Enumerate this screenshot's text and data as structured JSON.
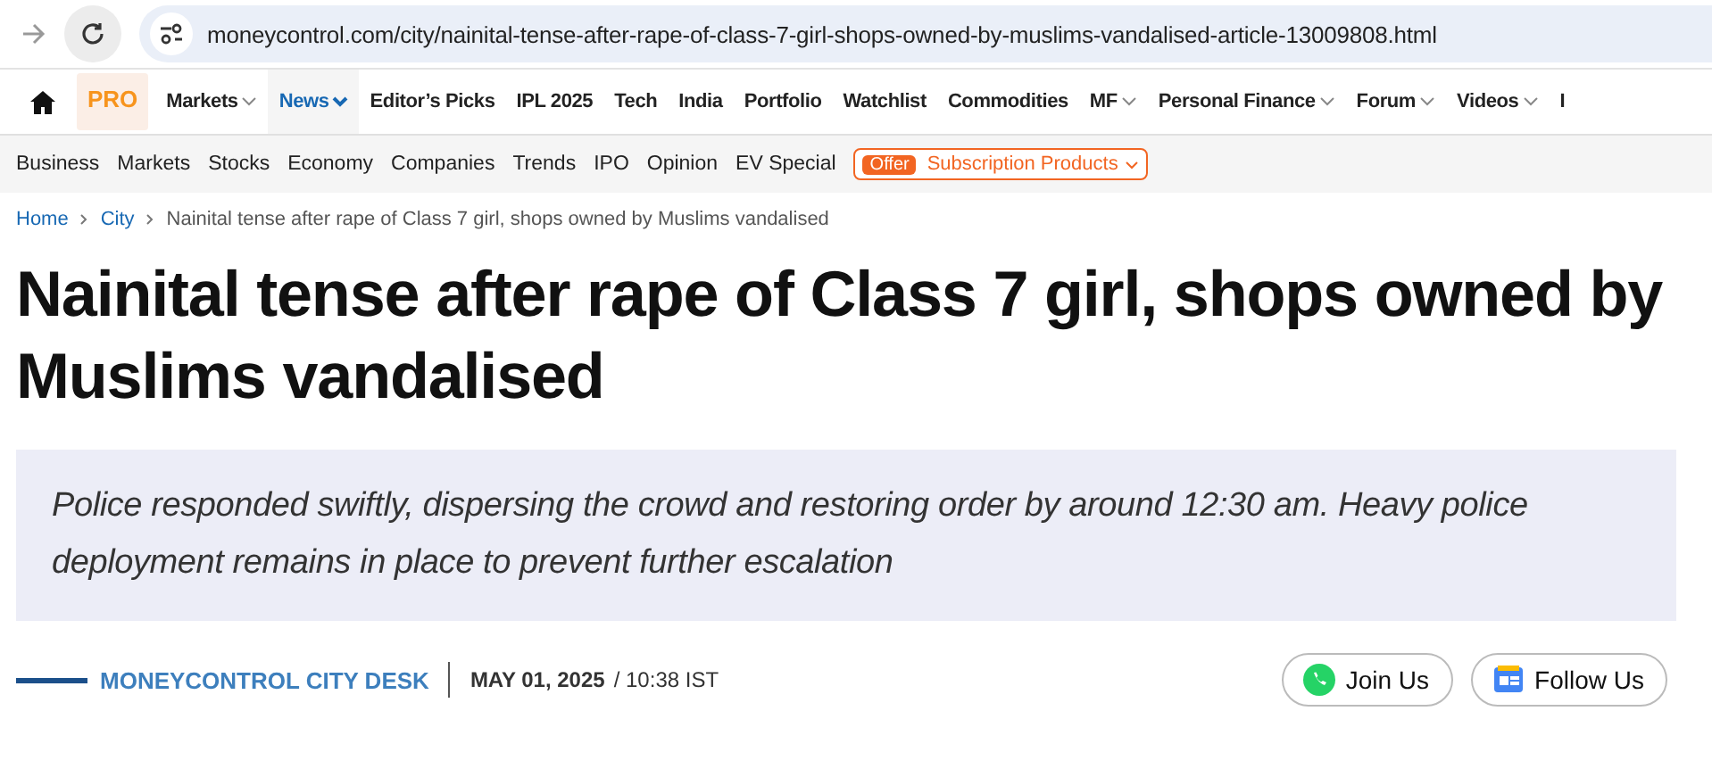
{
  "browser": {
    "url": "moneycontrol.com/city/nainital-tense-after-rape-of-class-7-girl-shops-owned-by-muslims-vandalised-article-13009808.html"
  },
  "main_nav": {
    "badge": "PRO",
    "items": [
      {
        "label": "Markets",
        "dropdown": true,
        "selected": false
      },
      {
        "label": "News",
        "dropdown": true,
        "selected": true
      },
      {
        "label": "Editor’s Picks",
        "dropdown": false,
        "selected": false
      },
      {
        "label": "IPL 2025",
        "dropdown": false,
        "selected": false
      },
      {
        "label": "Tech",
        "dropdown": false,
        "selected": false
      },
      {
        "label": "India",
        "dropdown": false,
        "selected": false
      },
      {
        "label": "Portfolio",
        "dropdown": false,
        "selected": false
      },
      {
        "label": "Watchlist",
        "dropdown": false,
        "selected": false
      },
      {
        "label": "Commodities",
        "dropdown": false,
        "selected": false
      },
      {
        "label": "MF",
        "dropdown": true,
        "selected": false
      },
      {
        "label": "Personal Finance",
        "dropdown": true,
        "selected": false
      },
      {
        "label": "Forum",
        "dropdown": true,
        "selected": false
      },
      {
        "label": "Videos",
        "dropdown": true,
        "selected": false
      },
      {
        "label": "I",
        "dropdown": false,
        "selected": false
      }
    ]
  },
  "sub_nav": {
    "items": [
      "Business",
      "Markets",
      "Stocks",
      "Economy",
      "Companies",
      "Trends",
      "IPO",
      "Opinion",
      "EV Special"
    ],
    "offer": {
      "tag": "Offer",
      "label": "Subscription Products"
    }
  },
  "breadcrumb": [
    "Home",
    "City",
    "Nainital tense after rape of Class 7 girl, shops owned by Muslims vandalised"
  ],
  "headline": "Nainital tense after rape of Class 7 girl, shops owned by Muslims vandalised",
  "summary": "Police responded swiftly, dispersing the crowd and restoring order by around 12:30 am. Heavy police deployment remains in place to prevent further escalation",
  "byline": {
    "author": "MONEYCONTROL CITY DESK",
    "date": "MAY 01, 2025",
    "time": "/ 10:38 IST"
  },
  "actions": [
    "Join Us",
    "Follow Us"
  ]
}
